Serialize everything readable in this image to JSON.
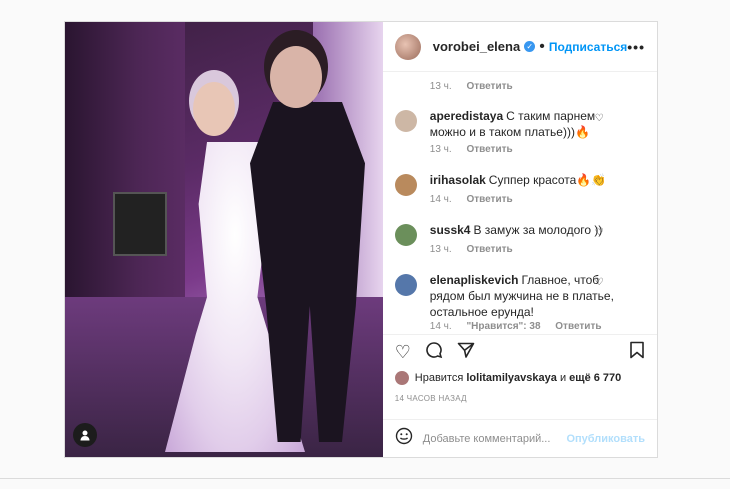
{
  "post": {
    "username": "vorobei_elena",
    "verified_mark": "✓",
    "dot": "•",
    "follow_label": "Подписаться",
    "more_label": "•••",
    "user_tag_icon": "person-icon"
  },
  "comments": {
    "top_meta": {
      "time": "13 ч.",
      "reply": "Ответить"
    },
    "items": [
      {
        "user": "aperedistaya",
        "text": "С таким парнем можно и в таком платье)))🔥",
        "time": "13 ч.",
        "reply": "Ответить",
        "avatar_color": "#cdb7a5"
      },
      {
        "user": "irihasolak",
        "text": "Суппер красота🔥👏",
        "time": "14 ч.",
        "reply": "Ответить",
        "avatar_color": "#b98a5d"
      },
      {
        "user": "sussk4",
        "text": "В замуж за молодого ))",
        "time": "13 ч.",
        "reply": "Ответить",
        "avatar_color": "#6b8f5b"
      },
      {
        "user": "elenapliskevich",
        "text": "Главное, чтоб рядом был мужчина не в платье, остальное ерунда!",
        "time": "14 ч.",
        "likes": "\"Нравится\": 38",
        "reply": "Ответить",
        "avatar_color": "#5577aa"
      }
    ]
  },
  "likes": {
    "prefix": "Нравится",
    "user": "lolitamilyavskaya",
    "middle": "и",
    "count": "ещё 6 770"
  },
  "timestamp": "14 ЧАСОВ НАЗАД",
  "add_comment": {
    "placeholder": "Добавьте комментарий...",
    "publish": "Опубликовать"
  }
}
